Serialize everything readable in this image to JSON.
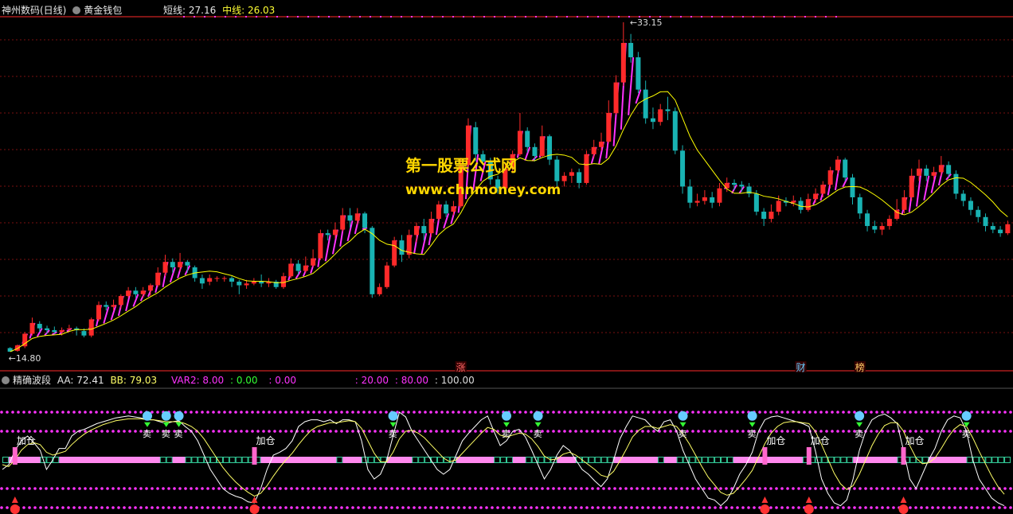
{
  "upper_header": {
    "stock_name": "神州数码(日线)",
    "indicator_name": "黄金钱包",
    "short_label": "短线: 27.16",
    "mid_label": "中线: 26.03"
  },
  "lower_header": {
    "indicator_name": "精确波段",
    "aa": "AA: 72.41",
    "bb": "BB: 79.03",
    "var2": "VAR2: 8.00",
    "v1": ": 0.00",
    "v2": ": 0.00",
    "v3": ": 20.00",
    "v4": ": 80.00",
    "v5": ": 100.00"
  },
  "watermark": {
    "line1": "第一股票公式网",
    "line2": "www.chnmoney.com"
  },
  "colors": {
    "up": "#ff2a2a",
    "down": "#19b3b3",
    "magenta": "#ff33ff",
    "yellow": "#ffff00",
    "grid": "#7a1010"
  },
  "chart_data": [
    {
      "type": "candlestick",
      "title": "神州数码(日线)",
      "ylim": [
        14.8,
        33.15
      ],
      "price_labels": {
        "high": "33.15",
        "low": "14.80"
      },
      "markers": [
        {
          "label": "涨",
          "index": 61
        },
        {
          "label": "财",
          "index": 107
        },
        {
          "label": "榜",
          "index": 115
        }
      ],
      "candles": [
        [
          15.0,
          14.8,
          15.05,
          14.8
        ],
        [
          14.85,
          15.15,
          15.2,
          14.8
        ],
        [
          15.1,
          15.8,
          15.9,
          15.0
        ],
        [
          15.8,
          16.4,
          16.7,
          15.7
        ],
        [
          16.35,
          16.1,
          16.5,
          15.9
        ],
        [
          16.1,
          16.0,
          16.25,
          15.8
        ],
        [
          16.0,
          15.9,
          16.2,
          15.8
        ],
        [
          15.9,
          16.0,
          16.15,
          15.7
        ],
        [
          16.05,
          16.1,
          16.3,
          15.9
        ],
        [
          16.1,
          16.0,
          16.2,
          15.7
        ],
        [
          15.95,
          15.7,
          16.1,
          15.6
        ],
        [
          15.7,
          16.6,
          16.7,
          15.6
        ],
        [
          16.6,
          17.4,
          17.6,
          16.5
        ],
        [
          17.4,
          17.3,
          17.6,
          17.1
        ],
        [
          17.3,
          17.4,
          17.7,
          17.1
        ],
        [
          17.4,
          17.9,
          18.0,
          17.2
        ],
        [
          17.9,
          18.2,
          18.4,
          17.8
        ],
        [
          18.2,
          18.0,
          18.4,
          17.8
        ],
        [
          18.0,
          18.2,
          18.4,
          17.8
        ],
        [
          18.2,
          18.5,
          18.6,
          17.9
        ],
        [
          18.5,
          19.2,
          19.5,
          18.4
        ],
        [
          19.2,
          19.8,
          20.2,
          19.0
        ],
        [
          19.8,
          19.5,
          20.0,
          19.2
        ],
        [
          19.5,
          19.8,
          20.3,
          19.3
        ],
        [
          19.8,
          19.6,
          19.9,
          19.2
        ],
        [
          19.5,
          18.9,
          19.6,
          18.7
        ],
        [
          18.9,
          18.6,
          19.1,
          18.3
        ],
        [
          18.7,
          18.9,
          19.1,
          18.5
        ],
        [
          18.9,
          18.9,
          19.0,
          18.7
        ],
        [
          18.9,
          18.9,
          19.0,
          18.7
        ],
        [
          18.9,
          18.7,
          19.0,
          18.4
        ],
        [
          18.7,
          18.5,
          18.8,
          18.0
        ],
        [
          18.5,
          18.6,
          18.8,
          18.3
        ],
        [
          18.6,
          18.7,
          18.9,
          18.5
        ],
        [
          18.7,
          18.6,
          19.1,
          18.4
        ],
        [
          18.6,
          18.7,
          18.9,
          18.4
        ],
        [
          18.7,
          18.4,
          18.8,
          18.3
        ],
        [
          18.4,
          19.0,
          19.2,
          18.3
        ],
        [
          19.0,
          19.7,
          20.0,
          18.9
        ],
        [
          19.7,
          19.3,
          19.9,
          19.1
        ],
        [
          19.3,
          19.6,
          20.1,
          19.2
        ],
        [
          19.6,
          20.0,
          20.5,
          19.5
        ],
        [
          20.0,
          21.4,
          21.6,
          19.9
        ],
        [
          21.4,
          21.3,
          21.6,
          21.0
        ],
        [
          21.3,
          21.6,
          22.0,
          21.1
        ],
        [
          21.6,
          22.4,
          22.8,
          21.5
        ],
        [
          22.4,
          22.1,
          22.8,
          21.7
        ],
        [
          22.1,
          22.5,
          22.8,
          21.9
        ],
        [
          22.5,
          21.7,
          22.6,
          21.4
        ],
        [
          21.7,
          18.0,
          21.8,
          17.8
        ],
        [
          18.0,
          18.4,
          18.6,
          17.9
        ],
        [
          18.4,
          19.6,
          19.8,
          18.3
        ],
        [
          19.6,
          21.0,
          21.2,
          19.5
        ],
        [
          21.0,
          20.2,
          21.3,
          19.8
        ],
        [
          20.2,
          21.3,
          21.6,
          20.0
        ],
        [
          21.3,
          21.8,
          22.0,
          20.9
        ],
        [
          21.8,
          21.4,
          22.2,
          21.0
        ],
        [
          21.4,
          22.2,
          22.6,
          21.2
        ],
        [
          22.2,
          23.0,
          23.2,
          22.1
        ],
        [
          23.0,
          22.5,
          23.2,
          22.3
        ],
        [
          22.6,
          22.9,
          23.2,
          22.4
        ],
        [
          22.9,
          25.2,
          25.6,
          22.8
        ],
        [
          25.2,
          27.4,
          27.8,
          25.0
        ],
        [
          27.3,
          25.8,
          27.6,
          25.4
        ],
        [
          25.8,
          25.4,
          26.0,
          25.2
        ],
        [
          25.4,
          24.4,
          25.6,
          24.1
        ],
        [
          24.4,
          23.9,
          24.6,
          23.6
        ],
        [
          23.9,
          25.0,
          25.3,
          23.8
        ],
        [
          25.0,
          25.8,
          26.0,
          24.8
        ],
        [
          25.8,
          27.1,
          28.1,
          25.7
        ],
        [
          27.1,
          26.2,
          27.3,
          25.9
        ],
        [
          26.2,
          25.7,
          26.4,
          25.4
        ],
        [
          25.7,
          26.8,
          27.4,
          25.6
        ],
        [
          26.8,
          25.5,
          26.9,
          25.2
        ],
        [
          25.5,
          24.3,
          25.7,
          24.0
        ],
        [
          24.3,
          24.6,
          24.8,
          24.0
        ],
        [
          24.6,
          24.8,
          25.0,
          24.2
        ],
        [
          24.8,
          24.2,
          25.0,
          23.9
        ],
        [
          24.2,
          25.8,
          26.0,
          24.1
        ],
        [
          25.8,
          26.2,
          26.6,
          25.6
        ],
        [
          26.2,
          26.5,
          27.0,
          26.0
        ],
        [
          26.5,
          28.1,
          28.8,
          26.4
        ],
        [
          28.1,
          29.8,
          30.2,
          28.0
        ],
        [
          29.8,
          32.0,
          33.15,
          29.6
        ],
        [
          32.0,
          31.2,
          32.5,
          30.9
        ],
        [
          31.2,
          29.4,
          31.5,
          29.2
        ],
        [
          29.4,
          27.8,
          29.9,
          27.5
        ],
        [
          27.8,
          27.6,
          28.4,
          27.2
        ],
        [
          27.6,
          28.3,
          28.6,
          27.4
        ],
        [
          28.3,
          28.2,
          29.0,
          27.7
        ],
        [
          28.2,
          26.0,
          28.4,
          25.8
        ],
        [
          26.0,
          24.0,
          26.3,
          23.6
        ],
        [
          24.0,
          23.1,
          24.4,
          22.8
        ],
        [
          23.1,
          23.2,
          23.6,
          22.9
        ],
        [
          23.2,
          23.4,
          23.8,
          23.0
        ],
        [
          23.4,
          23.1,
          23.7,
          22.8
        ],
        [
          23.1,
          23.9,
          24.2,
          22.9
        ],
        [
          23.9,
          24.2,
          24.5,
          23.7
        ],
        [
          24.2,
          24.1,
          24.4,
          23.8
        ],
        [
          24.1,
          24.0,
          24.3,
          23.7
        ],
        [
          24.0,
          23.6,
          24.2,
          23.4
        ],
        [
          23.6,
          22.6,
          23.8,
          22.4
        ],
        [
          22.6,
          22.2,
          22.8,
          21.8
        ],
        [
          22.2,
          22.6,
          23.0,
          22.0
        ],
        [
          22.6,
          23.2,
          23.5,
          22.4
        ],
        [
          23.2,
          23.1,
          23.4,
          22.9
        ],
        [
          23.1,
          23.2,
          23.5,
          22.9
        ],
        [
          23.2,
          22.7,
          23.4,
          22.5
        ],
        [
          22.7,
          23.3,
          23.6,
          22.6
        ],
        [
          23.3,
          23.6,
          23.9,
          23.1
        ],
        [
          23.6,
          24.1,
          24.3,
          23.4
        ],
        [
          24.1,
          24.9,
          25.1,
          23.9
        ],
        [
          24.9,
          25.5,
          25.7,
          24.7
        ],
        [
          25.5,
          24.5,
          25.6,
          24.3
        ],
        [
          24.5,
          23.4,
          24.7,
          23.0
        ],
        [
          23.4,
          22.5,
          23.6,
          22.2
        ],
        [
          22.5,
          21.8,
          22.7,
          21.5
        ],
        [
          21.8,
          21.6,
          22.1,
          21.4
        ],
        [
          21.6,
          21.8,
          22.0,
          21.3
        ],
        [
          21.8,
          22.2,
          22.4,
          21.6
        ],
        [
          22.2,
          22.7,
          23.3,
          22.1
        ],
        [
          22.7,
          23.4,
          23.8,
          22.5
        ],
        [
          23.4,
          24.6,
          25.0,
          23.2
        ],
        [
          24.6,
          25.0,
          25.5,
          24.3
        ],
        [
          25.0,
          24.6,
          25.2,
          24.3
        ],
        [
          24.6,
          24.8,
          25.1,
          24.4
        ],
        [
          24.8,
          25.2,
          25.7,
          24.6
        ],
        [
          25.2,
          24.7,
          25.4,
          24.5
        ],
        [
          24.7,
          23.6,
          24.9,
          23.3
        ],
        [
          23.6,
          23.2,
          23.8,
          22.9
        ],
        [
          23.2,
          22.7,
          23.4,
          22.4
        ],
        [
          22.7,
          22.3,
          22.9,
          22.0
        ],
        [
          22.3,
          21.8,
          22.5,
          21.5
        ],
        [
          21.8,
          21.6,
          22.0,
          21.4
        ],
        [
          21.6,
          21.4,
          21.8,
          21.2
        ],
        [
          21.4,
          21.9,
          22.1,
          21.3
        ]
      ]
    },
    {
      "type": "line",
      "title": "精确波段",
      "ylim": [
        0,
        100
      ],
      "levels": [
        0,
        20,
        80,
        100
      ],
      "ribbon_level": 50,
      "markers_sell": {
        "label": "卖",
        "indices": [
          23,
          26,
          28,
          62,
          80,
          85,
          108,
          136,
          119,
          153
        ]
      },
      "markers_add": {
        "label": "加仓",
        "indices": [
          2,
          40,
          121,
          128,
          143
        ]
      },
      "series": [
        {
          "color": "#ffffff",
          "values": [
            40,
            45,
            60,
            70,
            75,
            68,
            60,
            40,
            50,
            62,
            62,
            75,
            80,
            82,
            85,
            88,
            90,
            92,
            94,
            95,
            96,
            95,
            94,
            92,
            92,
            90,
            88,
            90,
            91,
            85,
            80,
            70,
            55,
            40,
            30,
            20,
            15,
            12,
            10,
            6,
            5,
            20,
            40,
            55,
            58,
            62,
            70,
            85,
            90,
            92,
            92,
            90,
            92,
            88,
            92,
            92,
            90,
            70,
            40,
            30,
            35,
            50,
            75,
            100,
            95,
            80,
            70,
            60,
            50,
            40,
            35,
            40,
            55,
            70,
            78,
            85,
            92,
            96,
            80,
            65,
            70,
            80,
            82,
            74,
            60,
            45,
            30,
            40,
            55,
            65,
            60,
            50,
            40,
            35,
            28,
            22,
            30,
            50,
            72,
            85,
            96,
            94,
            92,
            85,
            80,
            90,
            92,
            80,
            60,
            45,
            30,
            20,
            10,
            8,
            2,
            8,
            20,
            35,
            45,
            58,
            80,
            92,
            95,
            96,
            94,
            92,
            90,
            88,
            85,
            60,
            30,
            15,
            5,
            2,
            8,
            30,
            60,
            80,
            92,
            96,
            98,
            94,
            88,
            60,
            30,
            20,
            35,
            50,
            62,
            80,
            92,
            96,
            94,
            80,
            50,
            30,
            20,
            10,
            5,
            2
          ]
        },
        {
          "color": "#ffff66",
          "values": [
            45,
            43,
            50,
            60,
            66,
            68,
            66,
            58,
            55,
            57,
            59,
            66,
            72,
            77,
            81,
            84,
            87,
            89,
            91,
            92,
            93,
            93,
            93,
            92,
            92,
            91,
            90,
            90,
            90,
            88,
            85,
            80,
            72,
            62,
            52,
            42,
            34,
            27,
            21,
            16,
            12,
            15,
            23,
            33,
            42,
            50,
            57,
            66,
            74,
            81,
            85,
            87,
            89,
            89,
            90,
            91,
            90,
            83,
            70,
            57,
            48,
            48,
            58,
            72,
            80,
            81,
            78,
            73,
            66,
            59,
            52,
            48,
            50,
            57,
            64,
            71,
            78,
            84,
            82,
            76,
            74,
            76,
            78,
            77,
            72,
            64,
            54,
            50,
            51,
            56,
            58,
            55,
            50,
            45,
            40,
            34,
            32,
            38,
            49,
            61,
            74,
            81,
            85,
            85,
            83,
            85,
            87,
            85,
            77,
            67,
            55,
            43,
            32,
            24,
            16,
            13,
            15,
            22,
            30,
            39,
            53,
            67,
            78,
            85,
            89,
            90,
            90,
            89,
            88,
            80,
            66,
            51,
            36,
            25,
            19,
            23,
            35,
            50,
            65,
            77,
            86,
            89,
            89,
            80,
            65,
            52,
            46,
            47,
            52,
            62,
            73,
            82,
            87,
            85,
            73,
            59,
            46,
            33,
            22,
            14
          ]
        }
      ]
    }
  ]
}
